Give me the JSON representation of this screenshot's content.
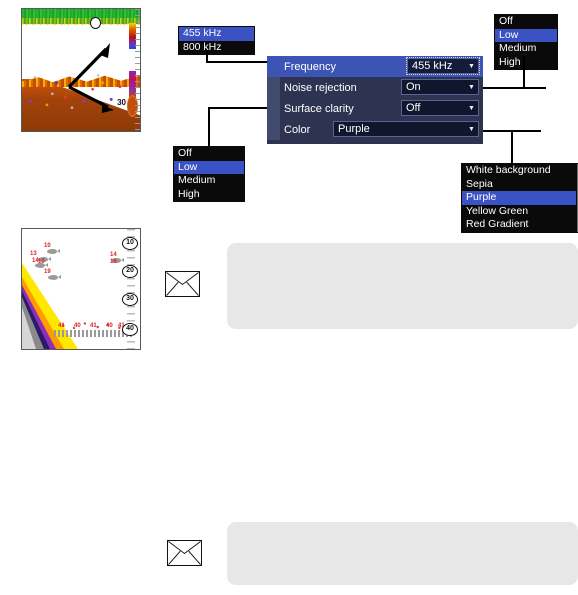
{
  "menu": {
    "rows": [
      {
        "label": "Frequency",
        "value": "455 kHz",
        "highlighted": true,
        "focused": true
      },
      {
        "label": "Noise rejection",
        "value": "On",
        "highlighted": false,
        "focused": false
      },
      {
        "label": "Surface clarity",
        "value": "Off",
        "highlighted": false,
        "focused": false
      },
      {
        "label": "Color",
        "value": "Purple",
        "highlighted": false,
        "focused": false
      }
    ],
    "arrow_glyph": "▼"
  },
  "lists": {
    "frequency": {
      "name": "frequency-list",
      "items": [
        {
          "label": "455 kHz",
          "selected": true
        },
        {
          "label": "800 kHz",
          "selected": false
        }
      ]
    },
    "surface_clarity": {
      "name": "surface-clarity-list",
      "items": [
        {
          "label": "Off",
          "selected": false
        },
        {
          "label": "Low",
          "selected": true
        },
        {
          "label": "Medium",
          "selected": false
        },
        {
          "label": "High",
          "selected": false
        }
      ]
    },
    "noise_rejection": {
      "name": "noise-rejection-list",
      "items": [
        {
          "label": "Off",
          "selected": false
        },
        {
          "label": "Low",
          "selected": true
        },
        {
          "label": "Medium",
          "selected": false
        },
        {
          "label": "High",
          "selected": false
        }
      ]
    },
    "color": {
      "name": "color-list",
      "scroll_up": "▲",
      "scroll_down": "▼",
      "items": [
        {
          "label": "White background",
          "selected": false
        },
        {
          "label": "Sepia",
          "selected": false
        },
        {
          "label": "Purple",
          "selected": true
        },
        {
          "label": "Yellow Green",
          "selected": false
        },
        {
          "label": "Red Gradient",
          "selected": false
        }
      ]
    }
  },
  "sonar_top": {
    "depth_label": "30"
  },
  "sonar_bottom": {
    "scale_labels": [
      "10",
      "20",
      "30",
      "40"
    ],
    "fish_depths": [
      "10",
      "13",
      "14",
      "10",
      "19",
      "14",
      "16"
    ],
    "bottom_depths": [
      "41",
      "40",
      "41",
      "40",
      "41",
      "40",
      "41"
    ]
  },
  "notes": [
    {
      "name": "note-box-upper",
      "text": ""
    },
    {
      "name": "note-box-lower",
      "text": ""
    }
  ],
  "colors": {
    "menu_bg": "#2d3350",
    "menu_highlight": "#3c55b4",
    "list_selection": "#3b52c4",
    "list_bg": "#0a0a0a",
    "note_bg": "#e7e7e7",
    "connector": "#000000"
  }
}
